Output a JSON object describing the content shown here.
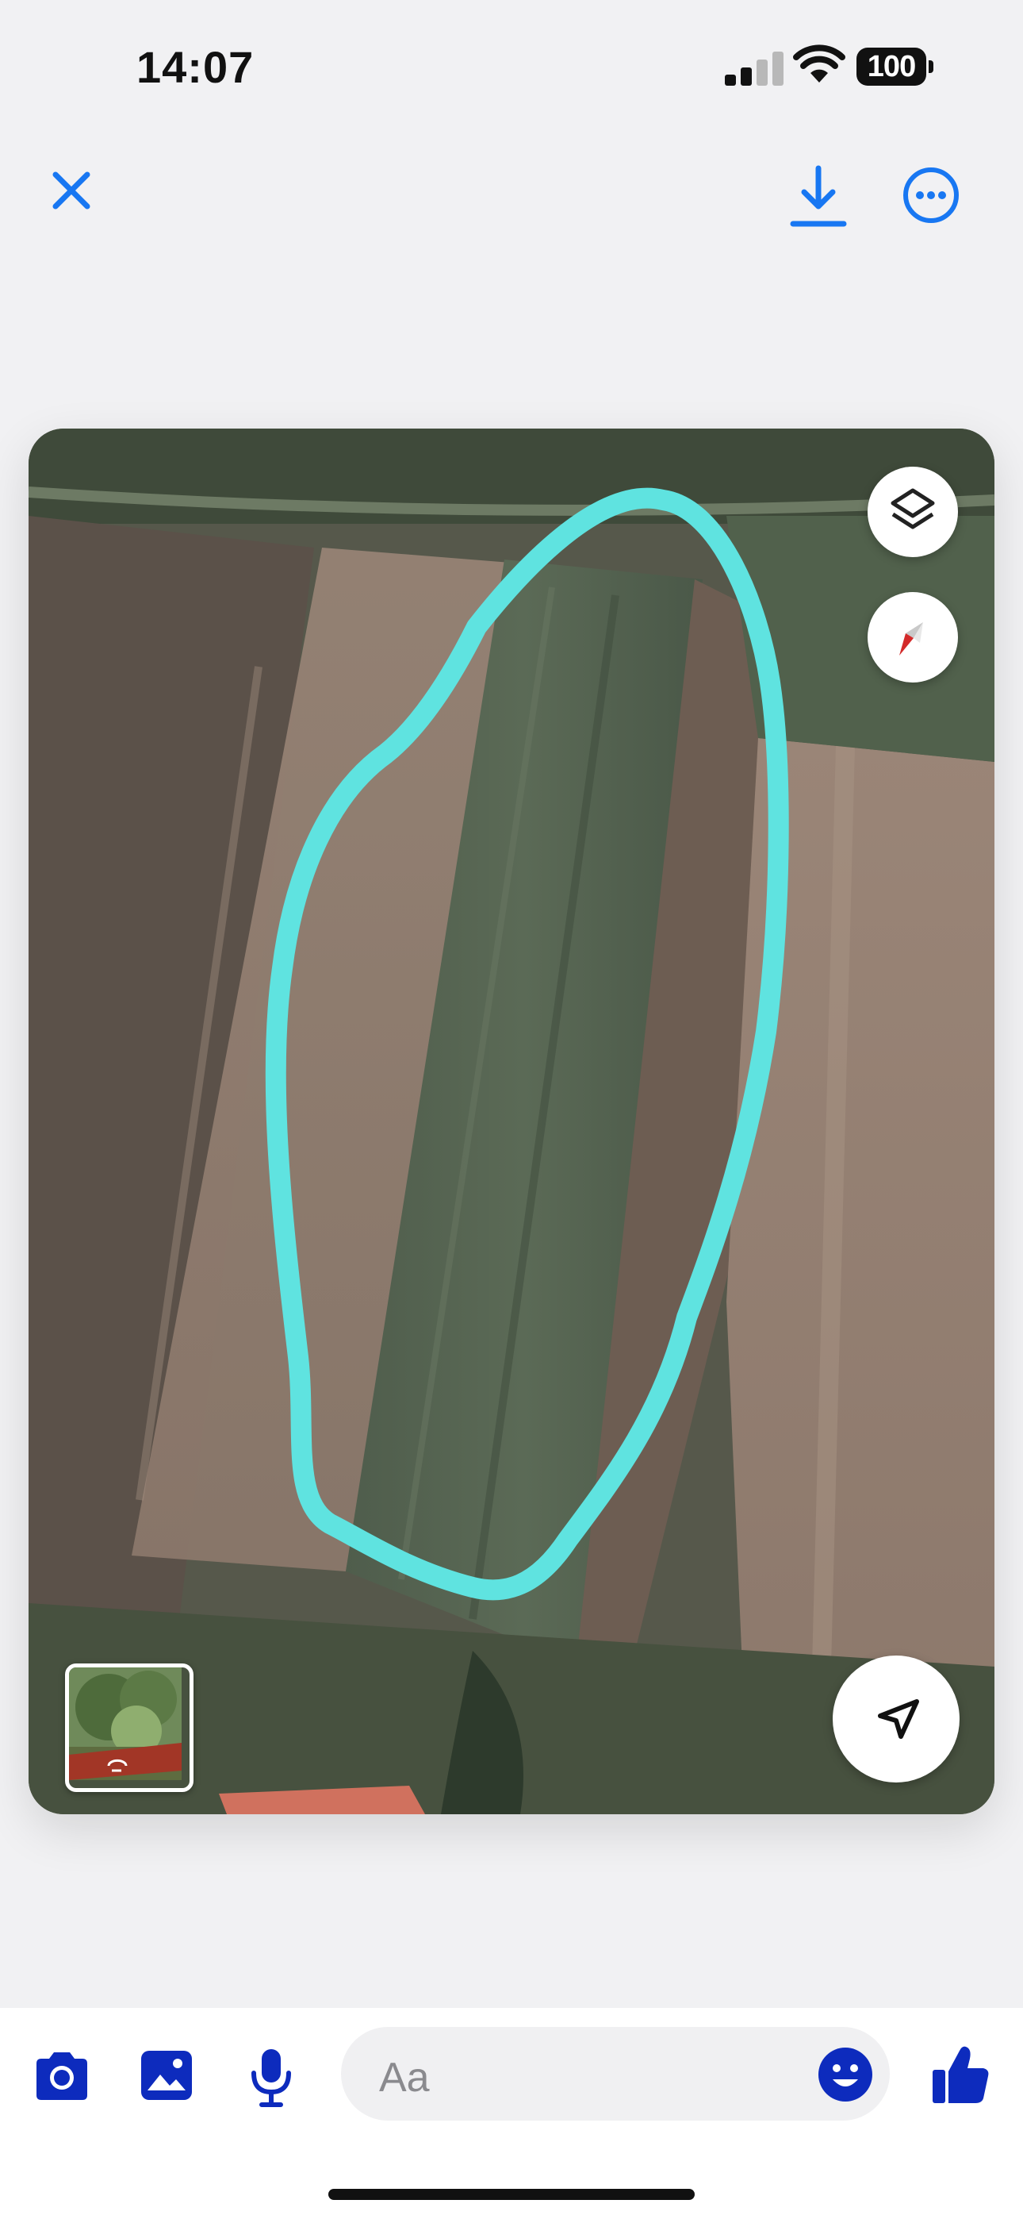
{
  "status_bar": {
    "time": "14:07",
    "battery": "100",
    "signal_bars_active": 2,
    "signal_bars_total": 4
  },
  "toolbar": {
    "close": "close-icon",
    "download": "download-icon",
    "more": "more-icon"
  },
  "map": {
    "type": "satellite",
    "controls": [
      "layers-icon",
      "compass-icon",
      "navigate-arrow-icon"
    ],
    "outline_color": "#5fe3e0",
    "streetview_thumbnail": "street-view-preview"
  },
  "composer": {
    "placeholder": "Aa",
    "icons": [
      "camera-icon",
      "photo-icon",
      "microphone-icon",
      "emoji-icon",
      "thumbs-up-icon"
    ]
  },
  "colors": {
    "accent": "#1877f2",
    "compose_icon": "#0d2bbd"
  }
}
